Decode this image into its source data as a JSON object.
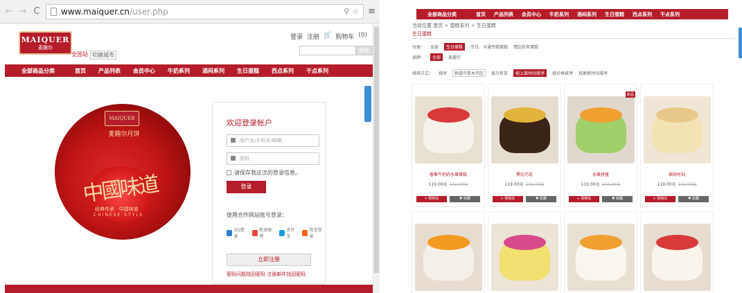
{
  "browser": {
    "url": "www.maiquer.cn/user.php",
    "url_host": "www.maiquer.cn",
    "url_path": "/user.php",
    "back_icon": "arrow-left",
    "forward_icon": "arrow-right",
    "reload_icon": "reload",
    "menu_icon": "hamburger"
  },
  "header": {
    "logo_text": "MAIQUER",
    "logo_sub": "麦趣尔",
    "site_label": "全国站",
    "switch_city": "切换城市",
    "login_link": "登录",
    "register_link": "注册",
    "cart_label": "购物车",
    "cart_count": "(0)",
    "search_button": "搜索"
  },
  "nav": {
    "all_label": "全部商品分类",
    "items": [
      "首页",
      "产品列表",
      "会员中心",
      "牛奶系列",
      "酒闷系列",
      "生日蛋糕",
      "西点系列",
      "干点系列"
    ]
  },
  "banner": {
    "logo_text": "MAIQUER",
    "title": "麦趣尔月饼",
    "calligraphy": "中國味道",
    "sub1": "经典传承 · 中国味道",
    "sub2": "CHINESE STYLE"
  },
  "login": {
    "title": "欢迎登录帐户",
    "username_placeholder": "用户名/手机号/邮箱",
    "password_placeholder": "密码",
    "remember": "请保存我这次的登录信息。",
    "login_button": "登录",
    "partner_text": "使用合作网站账号登录：",
    "partners": [
      "QQ登录",
      "新浪微博",
      "支付宝",
      "淘宝登录"
    ],
    "register_button": "立即注册",
    "forgot": "密码问题找回密码  注册邮件找回密码"
  },
  "right": {
    "nav_all": "全部商品分类",
    "nav_items": [
      "首页",
      "产品列表",
      "会员中心",
      "牛奶系列",
      "酒闷系列",
      "生日蛋糕",
      "西点系列",
      "干点系列"
    ],
    "breadcrumb": "当前位置 首页 > 蛋糕系列 > 生日蛋糕",
    "category": "生日蛋糕",
    "filter_label": "分类：",
    "filters": [
      "全部",
      "生日蛋糕",
      "节日、卡通专题蛋糕",
      "情比较有蛋糕"
    ],
    "brand_label": "品牌：",
    "brands": [
      "全部",
      "麦趣尔"
    ],
    "sort_label": "排排方式：",
    "sort_by": "排序",
    "region": "新疆乌鲁木齐区",
    "show": "显示有货",
    "sort_options": [
      "按上架时间排序",
      "按价格排序",
      "按更新时间排序"
    ],
    "products": [
      {
        "name": "香蕉牛奶奶水果蛋糕",
        "price": "119.00元",
        "old": "142.00元",
        "badge": ""
      },
      {
        "name": "黑比巧克",
        "price": "119.00元",
        "old": "142.00元",
        "badge": ""
      },
      {
        "name": "水果拼盘",
        "price": "119.00元",
        "old": "142.00元",
        "badge": "新品"
      },
      {
        "name": "缤纷时刻",
        "price": "119.00元",
        "old": "142.00元",
        "badge": ""
      },
      {
        "name": "",
        "price": "",
        "old": "",
        "badge": ""
      },
      {
        "name": "",
        "price": "",
        "old": "",
        "badge": ""
      },
      {
        "name": "",
        "price": "",
        "old": "",
        "badge": ""
      },
      {
        "name": "",
        "price": "",
        "old": "",
        "badge": ""
      }
    ],
    "buy_label": "+ 购物车",
    "fav_label": "♥ 收藏"
  },
  "colors": {
    "brand_red": "#b51d2a",
    "blue_tab": "#3d8fd6"
  }
}
